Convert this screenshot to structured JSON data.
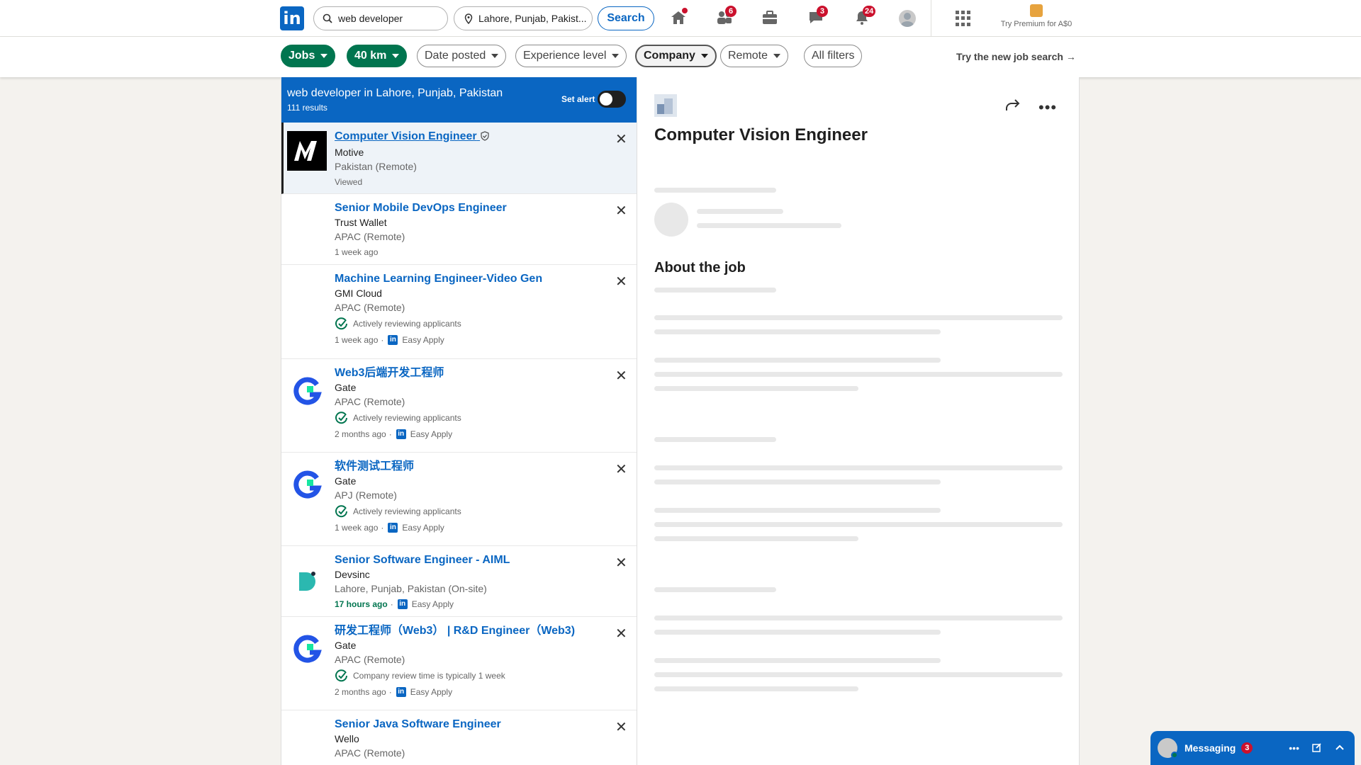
{
  "nav": {
    "logo": "in",
    "search_value": "web developer",
    "location_value": "Lahore, Punjab, Pakist...",
    "search_button": "Search",
    "badges": {
      "network": "6",
      "messaging": "3",
      "notifications": "24"
    },
    "premium_label": "Try Premium for A$0"
  },
  "filters": {
    "jobs": "Jobs",
    "distance": "40 km",
    "date_posted": "Date posted",
    "experience": "Experience level",
    "company": "Company",
    "remote": "Remote",
    "all_filters": "All filters",
    "try_new": "Try the new job search →"
  },
  "list": {
    "header_title": "web developer in Lahore, Punjab, Pakistan",
    "result_count": "111 results",
    "set_alert": "Set alert",
    "jobs": [
      {
        "title": "Computer Vision Engineer",
        "company": "Motive",
        "location": "Pakistan (Remote)",
        "insight": "",
        "time": "",
        "status": "Viewed",
        "easy_apply": ""
      },
      {
        "title": "Senior Mobile DevOps Engineer",
        "company": "Trust Wallet",
        "location": "APAC (Remote)",
        "insight": "",
        "time": "1 week ago",
        "status": "",
        "easy_apply": ""
      },
      {
        "title": "Machine Learning Engineer-Video Gen",
        "company": "GMI Cloud",
        "location": "APAC (Remote)",
        "insight": "Actively reviewing applicants",
        "time": "1 week ago",
        "status": "",
        "easy_apply": "Easy Apply"
      },
      {
        "title": "Web3后端开发工程师",
        "company": "Gate",
        "location": "APAC (Remote)",
        "insight": "Actively reviewing applicants",
        "time": "2 months ago",
        "status": "",
        "easy_apply": "Easy Apply"
      },
      {
        "title": "软件测试工程师",
        "company": "Gate",
        "location": "APJ (Remote)",
        "insight": "Actively reviewing applicants",
        "time": "1 week ago",
        "status": "",
        "easy_apply": "Easy Apply"
      },
      {
        "title": "Senior Software Engineer - AIML",
        "company": "Devsinc",
        "location": "Lahore, Punjab, Pakistan (On-site)",
        "insight": "",
        "time": "17 hours ago",
        "status": "",
        "easy_apply": "Easy Apply"
      },
      {
        "title": "研发工程师（Web3） | R&D Engineer（Web3)",
        "company": "Gate",
        "location": "APAC (Remote)",
        "insight": "Company review time is typically 1 week",
        "time": "2 months ago",
        "status": "",
        "easy_apply": "Easy Apply"
      },
      {
        "title": "Senior Java Software Engineer",
        "company": "Wello",
        "location": "APAC (Remote)",
        "insight": "",
        "time": "",
        "status": "",
        "easy_apply": ""
      }
    ]
  },
  "detail": {
    "title": "Computer Vision Engineer",
    "about_heading": "About the job"
  },
  "messaging": {
    "label": "Messaging",
    "count": "3"
  },
  "colors": {
    "brand_blue": "#0a66c2",
    "filter_green": "#01754f",
    "badge_red": "#cb112d"
  }
}
